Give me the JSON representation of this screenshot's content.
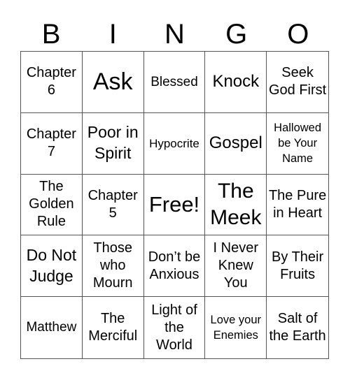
{
  "header": {
    "letters": [
      "B",
      "I",
      "N",
      "G",
      "O"
    ]
  },
  "cells": [
    "Chapter 6",
    "Ask",
    "Blessed",
    "Knock",
    "Seek God First",
    "Chapter 7",
    "Poor in Spirit",
    "Hypocrite",
    "Gospel",
    "Hallowed be Your Name",
    "The Golden Rule",
    "Chapter 5",
    "Free!",
    "The Meek",
    "The Pure in Heart",
    "Do Not Judge",
    "Those who Mourn",
    "Don’t be Anxious",
    "I Never Knew You",
    "By Their Fruits",
    "Matthew",
    "The Merciful",
    "Light of the World",
    "Love your Enemies",
    "Salt of the Earth"
  ]
}
